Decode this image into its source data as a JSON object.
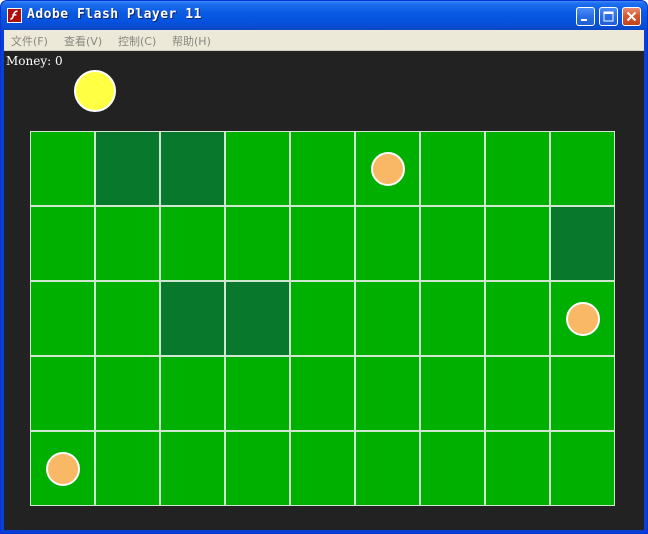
{
  "window": {
    "title": "Adobe Flash Player 11",
    "app_icon": "flash-icon",
    "controls": [
      "minimize-icon",
      "maximize-icon",
      "close-icon"
    ]
  },
  "menu": {
    "items": [
      {
        "label": "文件(F)"
      },
      {
        "label": "查看(V)"
      },
      {
        "label": "控制(C)"
      },
      {
        "label": "帮助(H)"
      }
    ]
  },
  "game": {
    "money_label": "Money: 0",
    "sun_color": "#ffff44",
    "grid": {
      "rows": 5,
      "cols": 9,
      "light_cell_color": "#00b000",
      "dark_cell_color": "#08782c",
      "dark_cells": [
        [
          0,
          1
        ],
        [
          0,
          2
        ],
        [
          1,
          8
        ],
        [
          2,
          2
        ],
        [
          2,
          3
        ]
      ],
      "orbs": [
        {
          "row": 0,
          "col": 5
        },
        {
          "row": 2,
          "col": 8
        },
        {
          "row": 4,
          "col": 0
        }
      ],
      "orb_color": "#f8b866"
    }
  }
}
